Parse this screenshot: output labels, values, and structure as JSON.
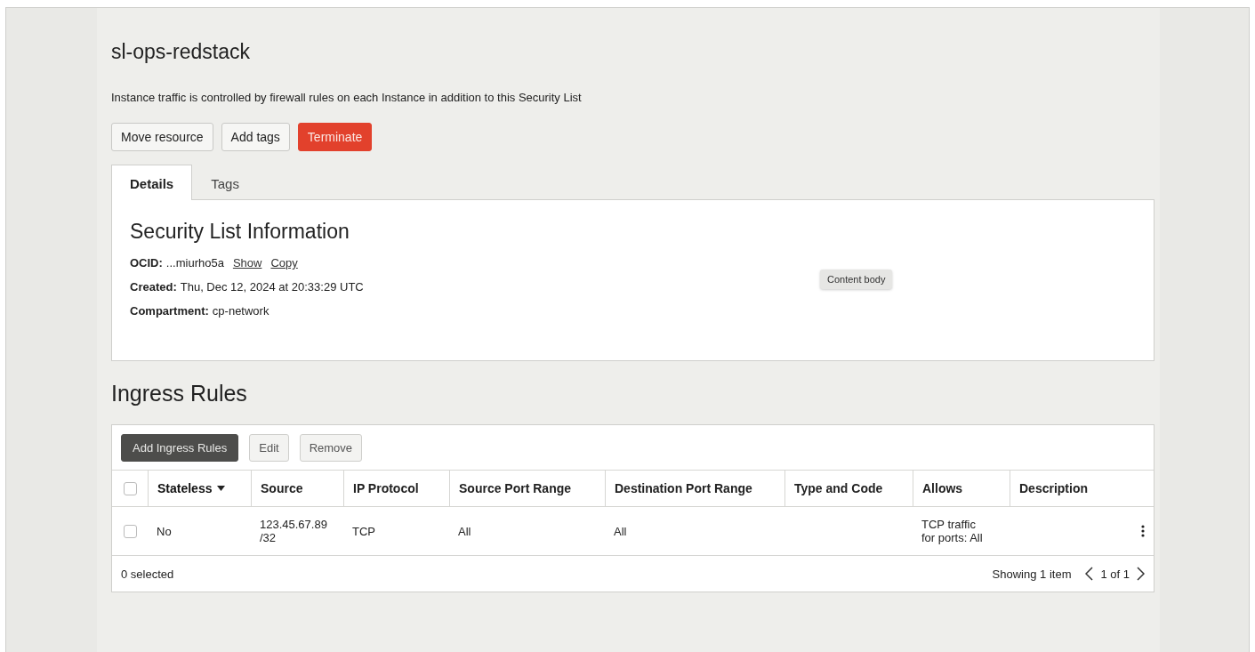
{
  "title": "sl-ops-redstack",
  "description": "Instance traffic is controlled by firewall rules on each Instance in addition to this Security List",
  "actions": [
    {
      "label": "Move resource",
      "kind": "default"
    },
    {
      "label": "Add tags",
      "kind": "default"
    },
    {
      "label": "Terminate",
      "kind": "danger"
    }
  ],
  "tabs": [
    {
      "label": "Details",
      "selected": true
    },
    {
      "label": "Tags",
      "selected": false
    }
  ],
  "details": {
    "heading": "Security List Information",
    "fields": [
      {
        "label": "OCID:",
        "value": "...miurho5a",
        "links": [
          "Show",
          "Copy"
        ]
      },
      {
        "label": "Created:",
        "value": "Thu, Dec 12, 2024 at 20:33:29 UTC"
      },
      {
        "label": "Compartment:",
        "value": "cp-network"
      }
    ],
    "tooltip": "Content body"
  },
  "ingress": {
    "heading": "Ingress Rules",
    "toolbar": [
      {
        "label": "Add Ingress Rules",
        "kind": "primary"
      },
      {
        "label": "Edit",
        "kind": "default"
      },
      {
        "label": "Remove",
        "kind": "default"
      }
    ],
    "header_checked": false,
    "columns": [
      {
        "label": "Stateless",
        "sorted": true
      },
      {
        "label": "Source",
        "sorted": false
      },
      {
        "label": "IP Protocol",
        "sorted": false
      },
      {
        "label": "Source Port Range",
        "sorted": false
      },
      {
        "label": "Destination Port Range",
        "sorted": false
      },
      {
        "label": "Type and Code",
        "sorted": false
      },
      {
        "label": "Allows",
        "sorted": false
      },
      {
        "label": "Description",
        "sorted": false
      }
    ],
    "rows": [
      {
        "checked": false,
        "cells": [
          "No",
          "123.45.67.89/32",
          "TCP",
          "All",
          "All",
          "",
          "TCP traffic for ports: All",
          ""
        ]
      }
    ],
    "selected_count": "0 selected",
    "showing": "Showing 1 item",
    "page": "1 of 1"
  }
}
